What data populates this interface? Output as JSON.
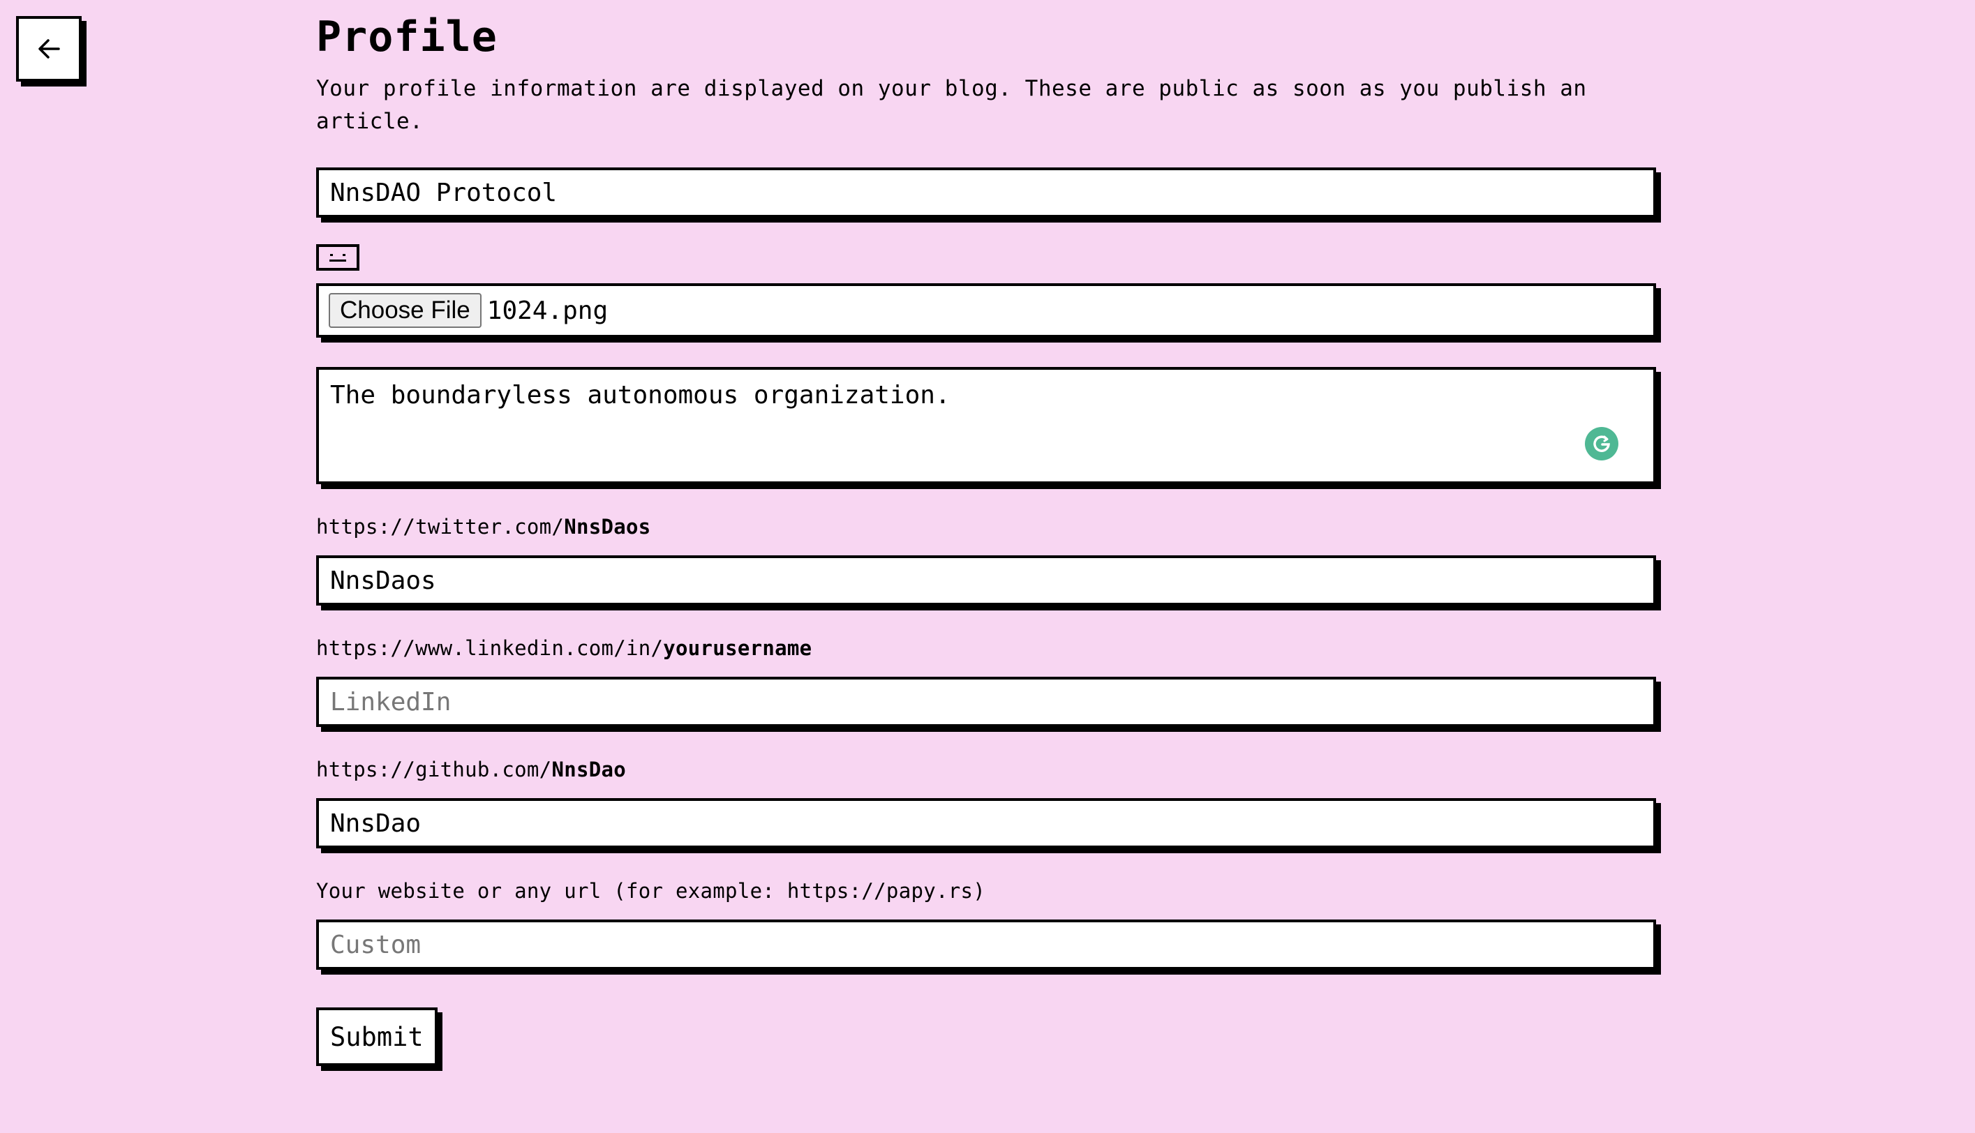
{
  "header": {
    "title": "Profile",
    "description": "Your profile information are displayed on your blog. These are public as soon as you publish an article."
  },
  "form": {
    "name_value": "NnsDAO Protocol",
    "file_button_label": "Choose File",
    "file_name": "1024.png",
    "bio_value": "The boundaryless autonomous organization.",
    "twitter": {
      "label_prefix": "https://twitter.com/",
      "label_bold": "NnsDaos",
      "value": "NnsDaos"
    },
    "linkedin": {
      "label_prefix": "https://www.linkedin.com/in/",
      "label_bold": "yourusername",
      "placeholder": "LinkedIn"
    },
    "github": {
      "label_prefix": "https://github.com/",
      "label_bold": "NnsDao",
      "value": "NnsDao"
    },
    "website": {
      "label": "Your website or any url (for example: https://papy.rs)",
      "placeholder": "Custom"
    },
    "submit_label": "Submit"
  },
  "icons": {
    "back": "arrow-left-icon",
    "avatar": "avatar-placeholder-icon",
    "grammarly": "grammarly-icon"
  },
  "colors": {
    "background": "#f8d6f2",
    "border": "#000000",
    "grammarly": "#4fb894"
  }
}
